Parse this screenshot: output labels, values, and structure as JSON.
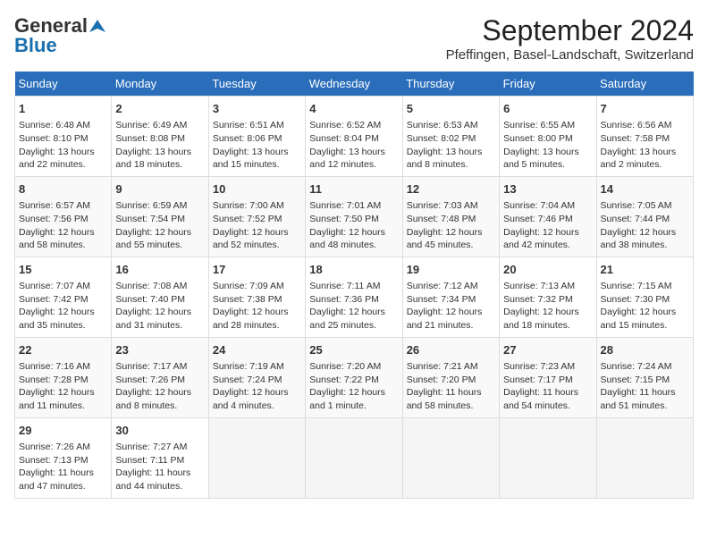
{
  "header": {
    "logo_general": "General",
    "logo_blue": "Blue",
    "month_title": "September 2024",
    "location": "Pfeffingen, Basel-Landschaft, Switzerland"
  },
  "columns": [
    "Sunday",
    "Monday",
    "Tuesday",
    "Wednesday",
    "Thursday",
    "Friday",
    "Saturday"
  ],
  "weeks": [
    [
      {
        "day": 1,
        "lines": [
          "Sunrise: 6:48 AM",
          "Sunset: 8:10 PM",
          "Daylight: 13 hours",
          "and 22 minutes."
        ]
      },
      {
        "day": 2,
        "lines": [
          "Sunrise: 6:49 AM",
          "Sunset: 8:08 PM",
          "Daylight: 13 hours",
          "and 18 minutes."
        ]
      },
      {
        "day": 3,
        "lines": [
          "Sunrise: 6:51 AM",
          "Sunset: 8:06 PM",
          "Daylight: 13 hours",
          "and 15 minutes."
        ]
      },
      {
        "day": 4,
        "lines": [
          "Sunrise: 6:52 AM",
          "Sunset: 8:04 PM",
          "Daylight: 13 hours",
          "and 12 minutes."
        ]
      },
      {
        "day": 5,
        "lines": [
          "Sunrise: 6:53 AM",
          "Sunset: 8:02 PM",
          "Daylight: 13 hours",
          "and 8 minutes."
        ]
      },
      {
        "day": 6,
        "lines": [
          "Sunrise: 6:55 AM",
          "Sunset: 8:00 PM",
          "Daylight: 13 hours",
          "and 5 minutes."
        ]
      },
      {
        "day": 7,
        "lines": [
          "Sunrise: 6:56 AM",
          "Sunset: 7:58 PM",
          "Daylight: 13 hours",
          "and 2 minutes."
        ]
      }
    ],
    [
      {
        "day": 8,
        "lines": [
          "Sunrise: 6:57 AM",
          "Sunset: 7:56 PM",
          "Daylight: 12 hours",
          "and 58 minutes."
        ]
      },
      {
        "day": 9,
        "lines": [
          "Sunrise: 6:59 AM",
          "Sunset: 7:54 PM",
          "Daylight: 12 hours",
          "and 55 minutes."
        ]
      },
      {
        "day": 10,
        "lines": [
          "Sunrise: 7:00 AM",
          "Sunset: 7:52 PM",
          "Daylight: 12 hours",
          "and 52 minutes."
        ]
      },
      {
        "day": 11,
        "lines": [
          "Sunrise: 7:01 AM",
          "Sunset: 7:50 PM",
          "Daylight: 12 hours",
          "and 48 minutes."
        ]
      },
      {
        "day": 12,
        "lines": [
          "Sunrise: 7:03 AM",
          "Sunset: 7:48 PM",
          "Daylight: 12 hours",
          "and 45 minutes."
        ]
      },
      {
        "day": 13,
        "lines": [
          "Sunrise: 7:04 AM",
          "Sunset: 7:46 PM",
          "Daylight: 12 hours",
          "and 42 minutes."
        ]
      },
      {
        "day": 14,
        "lines": [
          "Sunrise: 7:05 AM",
          "Sunset: 7:44 PM",
          "Daylight: 12 hours",
          "and 38 minutes."
        ]
      }
    ],
    [
      {
        "day": 15,
        "lines": [
          "Sunrise: 7:07 AM",
          "Sunset: 7:42 PM",
          "Daylight: 12 hours",
          "and 35 minutes."
        ]
      },
      {
        "day": 16,
        "lines": [
          "Sunrise: 7:08 AM",
          "Sunset: 7:40 PM",
          "Daylight: 12 hours",
          "and 31 minutes."
        ]
      },
      {
        "day": 17,
        "lines": [
          "Sunrise: 7:09 AM",
          "Sunset: 7:38 PM",
          "Daylight: 12 hours",
          "and 28 minutes."
        ]
      },
      {
        "day": 18,
        "lines": [
          "Sunrise: 7:11 AM",
          "Sunset: 7:36 PM",
          "Daylight: 12 hours",
          "and 25 minutes."
        ]
      },
      {
        "day": 19,
        "lines": [
          "Sunrise: 7:12 AM",
          "Sunset: 7:34 PM",
          "Daylight: 12 hours",
          "and 21 minutes."
        ]
      },
      {
        "day": 20,
        "lines": [
          "Sunrise: 7:13 AM",
          "Sunset: 7:32 PM",
          "Daylight: 12 hours",
          "and 18 minutes."
        ]
      },
      {
        "day": 21,
        "lines": [
          "Sunrise: 7:15 AM",
          "Sunset: 7:30 PM",
          "Daylight: 12 hours",
          "and 15 minutes."
        ]
      }
    ],
    [
      {
        "day": 22,
        "lines": [
          "Sunrise: 7:16 AM",
          "Sunset: 7:28 PM",
          "Daylight: 12 hours",
          "and 11 minutes."
        ]
      },
      {
        "day": 23,
        "lines": [
          "Sunrise: 7:17 AM",
          "Sunset: 7:26 PM",
          "Daylight: 12 hours",
          "and 8 minutes."
        ]
      },
      {
        "day": 24,
        "lines": [
          "Sunrise: 7:19 AM",
          "Sunset: 7:24 PM",
          "Daylight: 12 hours",
          "and 4 minutes."
        ]
      },
      {
        "day": 25,
        "lines": [
          "Sunrise: 7:20 AM",
          "Sunset: 7:22 PM",
          "Daylight: 12 hours",
          "and 1 minute."
        ]
      },
      {
        "day": 26,
        "lines": [
          "Sunrise: 7:21 AM",
          "Sunset: 7:20 PM",
          "Daylight: 11 hours",
          "and 58 minutes."
        ]
      },
      {
        "day": 27,
        "lines": [
          "Sunrise: 7:23 AM",
          "Sunset: 7:17 PM",
          "Daylight: 11 hours",
          "and 54 minutes."
        ]
      },
      {
        "day": 28,
        "lines": [
          "Sunrise: 7:24 AM",
          "Sunset: 7:15 PM",
          "Daylight: 11 hours",
          "and 51 minutes."
        ]
      }
    ],
    [
      {
        "day": 29,
        "lines": [
          "Sunrise: 7:26 AM",
          "Sunset: 7:13 PM",
          "Daylight: 11 hours",
          "and 47 minutes."
        ]
      },
      {
        "day": 30,
        "lines": [
          "Sunrise: 7:27 AM",
          "Sunset: 7:11 PM",
          "Daylight: 11 hours",
          "and 44 minutes."
        ]
      },
      null,
      null,
      null,
      null,
      null
    ]
  ]
}
